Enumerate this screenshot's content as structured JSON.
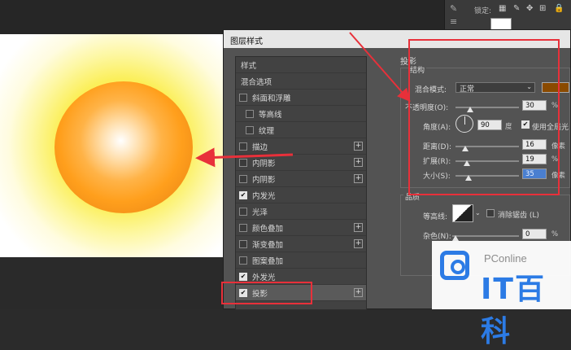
{
  "dialog": {
    "title": "图层样式"
  },
  "styles_list": [
    {
      "label": "样式",
      "type": "header"
    },
    {
      "label": "混合选项",
      "type": "header"
    },
    {
      "label": "斜面和浮雕",
      "checked": false,
      "indent": false,
      "plus": false
    },
    {
      "label": "等高线",
      "checked": false,
      "indent": true,
      "plus": false
    },
    {
      "label": "纹理",
      "checked": false,
      "indent": true,
      "plus": false
    },
    {
      "label": "描边",
      "checked": false,
      "indent": false,
      "plus": true
    },
    {
      "label": "内阴影",
      "checked": false,
      "indent": false,
      "plus": true
    },
    {
      "label": "内阴影",
      "checked": false,
      "indent": false,
      "plus": true
    },
    {
      "label": "内发光",
      "checked": true,
      "indent": false,
      "plus": false
    },
    {
      "label": "光泽",
      "checked": false,
      "indent": false,
      "plus": false
    },
    {
      "label": "颜色叠加",
      "checked": false,
      "indent": false,
      "plus": true
    },
    {
      "label": "渐变叠加",
      "checked": false,
      "indent": false,
      "plus": true
    },
    {
      "label": "图案叠加",
      "checked": false,
      "indent": false,
      "plus": false
    },
    {
      "label": "外发光",
      "checked": true,
      "indent": false,
      "plus": false
    },
    {
      "label": "投影",
      "checked": true,
      "indent": false,
      "plus": true,
      "selected": true
    }
  ],
  "panel": {
    "section_title": "投影",
    "structure_title": "结构",
    "blend_mode_label": "混合模式:",
    "blend_mode_value": "正常",
    "swatch_color": "#8a4a00",
    "opacity_label": "不透明度(O):",
    "opacity_value": "30",
    "opacity_unit": "%",
    "angle_label": "角度(A):",
    "angle_value": "90",
    "angle_unit": "度",
    "global_light_label": "使用全局光",
    "distance_label": "距离(D):",
    "distance_value": "16",
    "distance_unit": "像素",
    "spread_label": "扩展(R):",
    "spread_value": "19",
    "spread_unit": "%",
    "size_label": "大小(S):",
    "size_value": "35",
    "size_unit": "像素",
    "quality_title": "品质",
    "contour_label": "等高线:",
    "antialias_label": "消除锯齿 (L)",
    "noise_label": "杂色(N):",
    "noise_value": "0",
    "noise_unit": "%"
  },
  "topbar": {
    "lock_label": "锁定:"
  },
  "watermark": {
    "small": "PConline",
    "big": "IT百科"
  }
}
